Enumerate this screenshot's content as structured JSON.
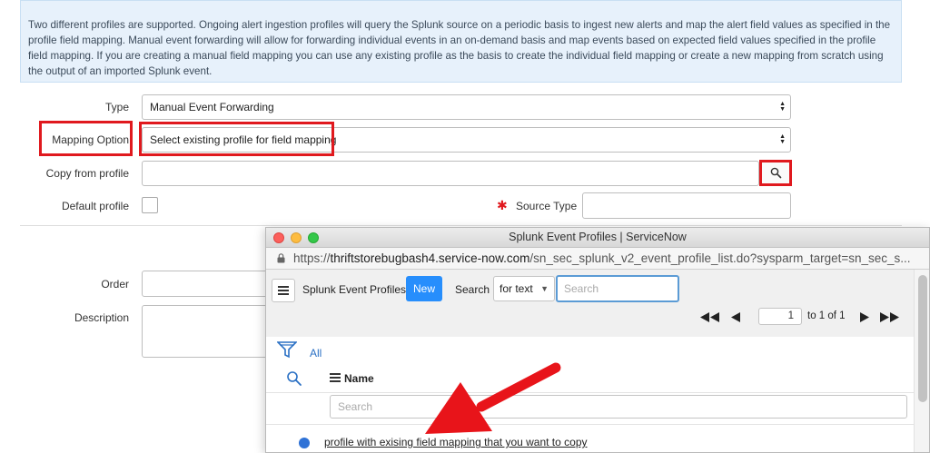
{
  "info": {
    "text": "Two different profiles are supported. Ongoing alert ingestion profiles will query the Splunk source on a periodic basis to ingest new alerts and map the alert field values as specified in the profile field mapping. Manual event forwarding will allow for forwarding individual events in an on-demand basis and map events based on expected field values specified in the profile field mapping. If you are creating a manual field mapping you can use any existing profile as the basis to create the individual field mapping or create a new mapping from scratch using the output of an imported Splunk event."
  },
  "form": {
    "type_label": "Type",
    "type_value": "Manual Event Forwarding",
    "mapping_label": "Mapping Option",
    "mapping_value": "Select existing profile for field mapping",
    "copy_label": "Copy from profile",
    "copy_value": "",
    "default_label": "Default profile",
    "source_type_label": "Source Type",
    "source_type_value": "",
    "order_label": "Order",
    "description_label": "Description",
    "required_marker": "✱"
  },
  "popup": {
    "title": "Splunk Event Profiles | ServiceNow",
    "url_prefix": "https://",
    "url_host": "thriftstorebugbash4.service-now.com",
    "url_path": "/sn_sec_splunk_v2_event_profile_list.do?sysparm_target=sn_sec_s...",
    "list_title": "Splunk Event Profiles",
    "new_button": "New",
    "search_label": "Search",
    "search_field": "for text",
    "search_placeholder": "Search",
    "page_current": "1",
    "page_of": "to 1 of 1",
    "filter_all": "All",
    "name_column": "Name",
    "name_search_placeholder": "Search",
    "rows": [
      {
        "name": "profile with exising field mapping that you want to copy"
      }
    ]
  },
  "colors": {
    "highlight": "#e0191e",
    "info_bg": "#e7f1fb",
    "new_button": "#278efc",
    "link": "#2a70c4"
  },
  "icons": {
    "lookup": "magnifier-icon",
    "menu": "hamburger-icon",
    "filter": "funnel-icon",
    "annotation": "red-arrow"
  }
}
